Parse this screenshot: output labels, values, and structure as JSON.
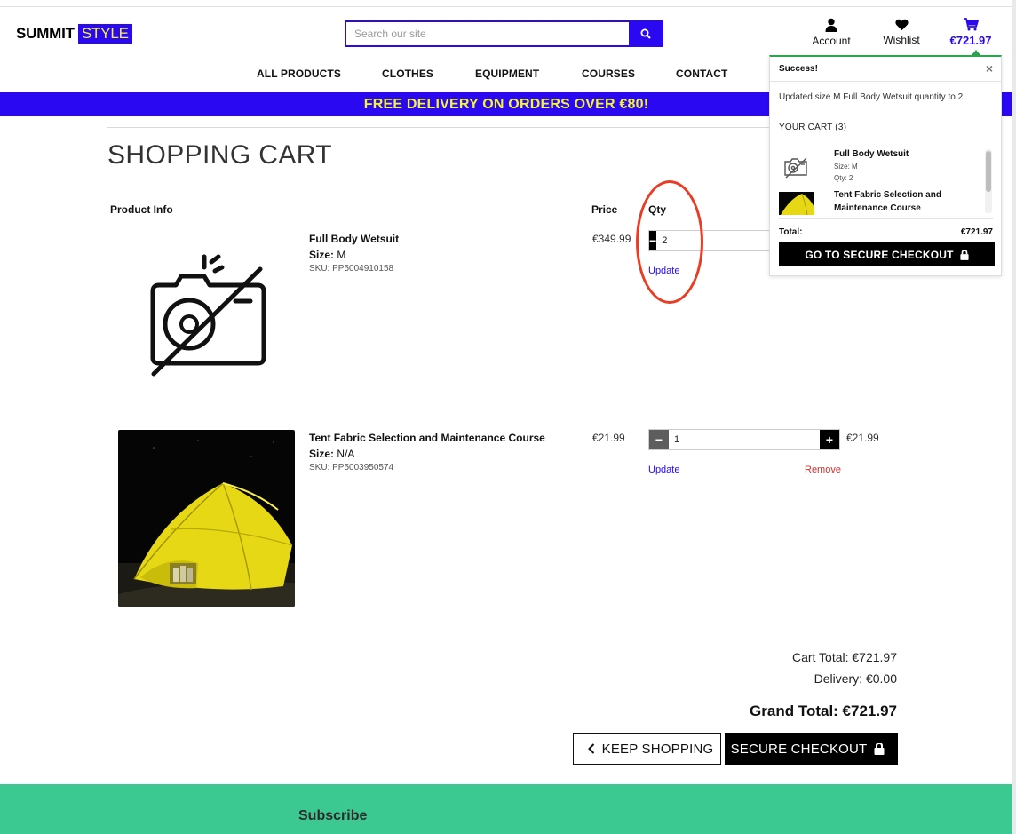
{
  "brand": {
    "part1": "SUMMIT",
    "part2": "STYLE"
  },
  "search": {
    "placeholder": "Search our site",
    "icon": "search-icon"
  },
  "header": {
    "account_label": "Account",
    "wishlist_label": "Wishlist",
    "bag_total": "€721.97"
  },
  "nav": [
    "ALL PRODUCTS",
    "CLOTHES",
    "EQUIPMENT",
    "COURSES",
    "CONTACT"
  ],
  "banner": "FREE DELIVERY ON ORDERS OVER €80!",
  "cart": {
    "title": "SHOPPING CART",
    "columns": {
      "info": "Product Info",
      "price": "Price",
      "qty": "Qty"
    },
    "size_label": "Size:",
    "items": [
      {
        "name": "Full Body Wetsuit",
        "size": "M",
        "sku": "SKU: PP5004910158",
        "price": "€349.99",
        "qty": "2",
        "update": "Update",
        "image": "no-image-camera-icon"
      },
      {
        "name": "Tent Fabric Selection and Maintenance Course",
        "size": "N/A",
        "sku": "SKU: PP5003950574",
        "price": "€21.99",
        "qty": "1",
        "subtotal": "€21.99",
        "update": "Update",
        "remove": "Remove",
        "image": "yellow-tent-photo"
      }
    ],
    "cart_total": "Cart Total: €721.97",
    "delivery": "Delivery: €0.00",
    "grand_total": "Grand Total: €721.97",
    "keep_shopping": "KEEP SHOPPING",
    "secure_checkout": "SECURE CHECKOUT"
  },
  "popup": {
    "title": "Success!",
    "message": "Updated size M Full Body Wetsuit quantity to 2",
    "your_cart": "YOUR CART (3)",
    "items": [
      {
        "name": "Full Body Wetsuit",
        "size": "Size: M",
        "qty": "Qty: 2"
      },
      {
        "name": "Tent Fabric Selection and Maintenance Course"
      }
    ],
    "total_label": "Total:",
    "total_value": "€721.97",
    "checkout": "GO TO SECURE CHECKOUT"
  },
  "footer": {
    "subscribe": "Subscribe"
  },
  "colors": {
    "brand": "#2a08f2",
    "banner_text": "#f4f438",
    "footer": "#3cc891",
    "success": "#2ea44f",
    "remove": "#d0312d"
  }
}
